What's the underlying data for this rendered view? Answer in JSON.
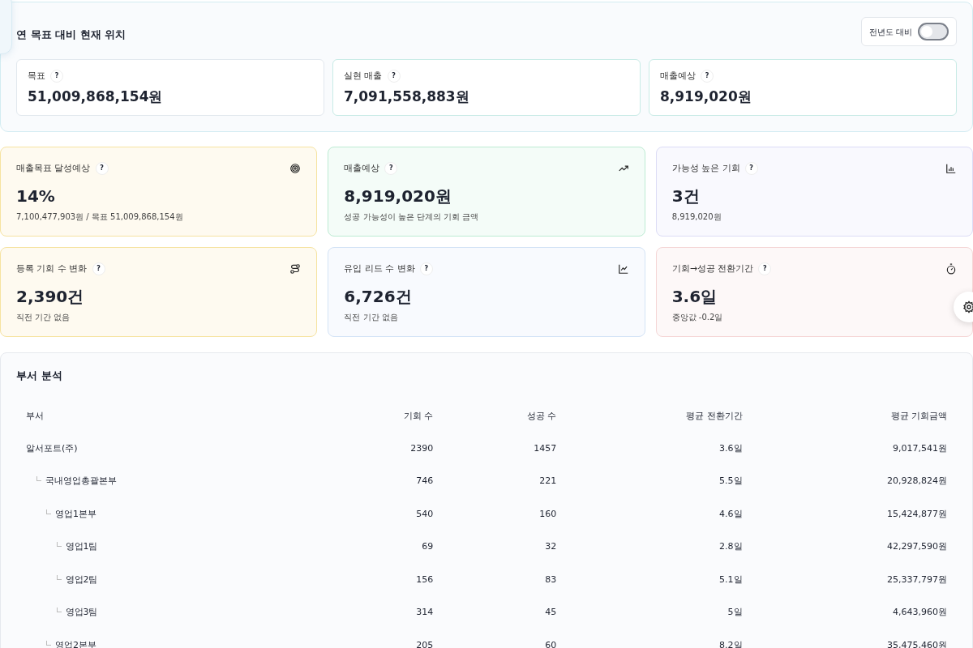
{
  "summary": {
    "title": "연 목표 대비 현재 위치",
    "toggle": {
      "label": "전년도 대비",
      "on": false
    },
    "items": [
      {
        "label": "목표",
        "help": "?",
        "value": "51,009,868,154원"
      },
      {
        "label": "실현 매출",
        "help": "?",
        "value": "7,091,558,883원"
      },
      {
        "label": "매출예상",
        "help": "?",
        "value": "8,919,020원"
      }
    ]
  },
  "kpis": [
    {
      "label": "매출목표 달성예상",
      "help": "?",
      "value": "14%",
      "sub": "7,100,477,903원 / 목표 51,009,868,154원",
      "color": "#f6e3a1"
    },
    {
      "label": "매출예상",
      "help": "?",
      "value": "8,919,020원",
      "sub": "성공 가능성이 높은 단계의 기회 금액",
      "color": "#bdebd3"
    },
    {
      "label": "가능성 높은 기회",
      "help": "?",
      "value": "3건",
      "sub": "8,919,020원",
      "color": "#dcdcf6"
    },
    {
      "label": "등록 기회 수 변화",
      "help": "?",
      "value": "2,390건",
      "sub": "직전 기간 없음",
      "color": "#f6e3a1"
    },
    {
      "label": "유입 리드 수 변화",
      "help": "?",
      "value": "6,726건",
      "sub": "직전 기간 없음",
      "color": "#d3e3f6"
    },
    {
      "label": "기회→성공 전환기간",
      "help": "?",
      "value": "3.6일",
      "sub": "중앙값 -0.2일",
      "color": "#f5d6d6"
    }
  ],
  "dept": {
    "title": "부서 분석",
    "columns": [
      "부서",
      "기회 수",
      "성공 수",
      "평균 전환기간",
      "평균 기회금액"
    ],
    "rows": [
      {
        "cells": [
          "알서포트(주)",
          "2390",
          "1457",
          "3.6일",
          "9,017,541원"
        ],
        "children": [
          {
            "cells": [
              "국내영업총괄본부",
              "746",
              "221",
              "5.5일",
              "20,928,824원"
            ],
            "children": [
              {
                "cells": [
                  "영업1본부",
                  "540",
                  "160",
                  "4.6일",
                  "15,424,877원"
                ],
                "children": [
                  {
                    "cells": [
                      "영업1팀",
                      "69",
                      "32",
                      "2.8일",
                      "42,297,590원"
                    ]
                  },
                  {
                    "cells": [
                      "영업2팀",
                      "156",
                      "83",
                      "5.1일",
                      "25,337,797원"
                    ]
                  },
                  {
                    "cells": [
                      "영업3팀",
                      "314",
                      "45",
                      "5일",
                      "4,643,960원"
                    ]
                  }
                ]
              },
              {
                "cells": [
                  "영업2본부",
                  "205",
                  "60",
                  "8.2일",
                  "35,475,460원"
                ]
              }
            ]
          }
        ]
      }
    ]
  }
}
